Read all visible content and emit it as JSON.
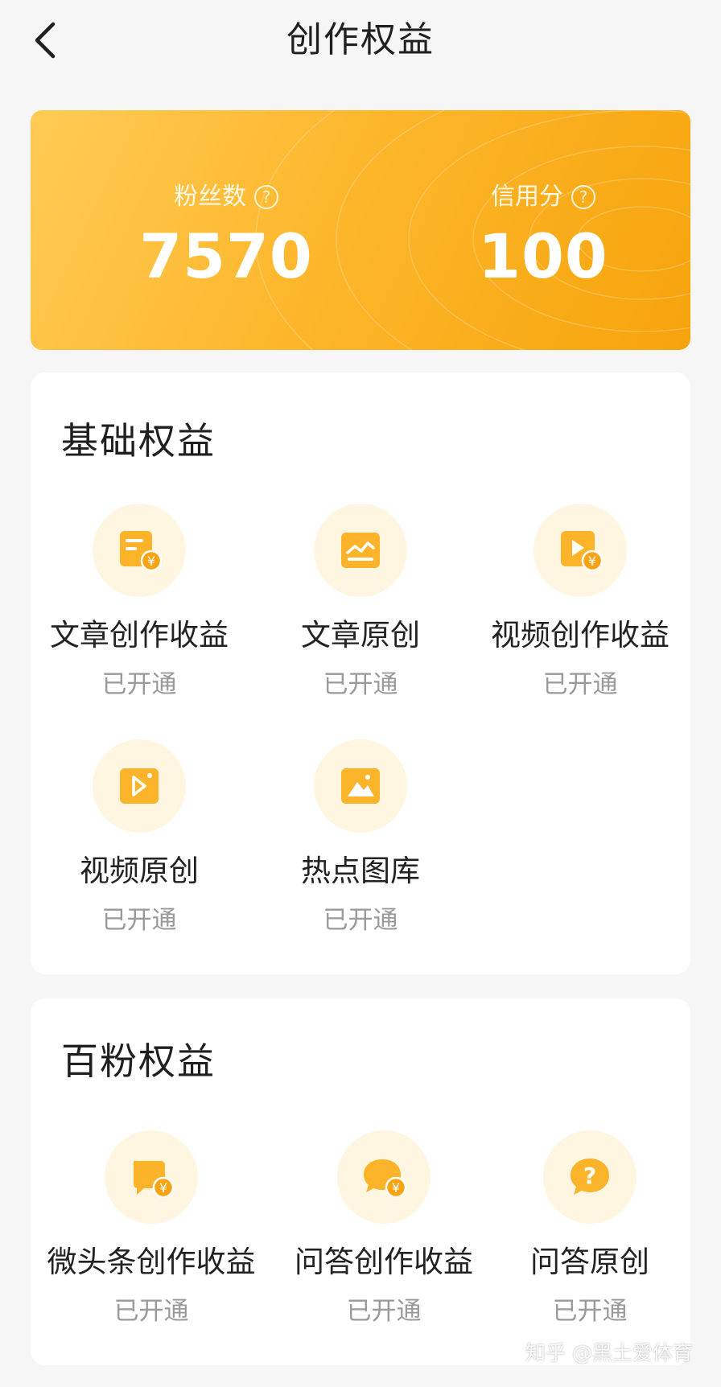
{
  "header": {
    "title": "创作权益"
  },
  "stats": {
    "fans_label": "粉丝数",
    "fans_value": "7570",
    "credit_label": "信用分",
    "credit_value": "100",
    "help_glyph": "?",
    "arrow_glyph": "›"
  },
  "basic": {
    "title": "基础权益",
    "items": [
      {
        "name": "文章创作收益",
        "status": "已开通",
        "icon": "article-income-icon"
      },
      {
        "name": "文章原创",
        "status": "已开通",
        "icon": "article-original-icon"
      },
      {
        "name": "视频创作收益",
        "status": "已开通",
        "icon": "video-income-icon"
      },
      {
        "name": "视频原创",
        "status": "已开通",
        "icon": "video-original-icon"
      },
      {
        "name": "热点图库",
        "status": "已开通",
        "icon": "image-gallery-icon"
      }
    ]
  },
  "fans100": {
    "title": "百粉权益",
    "items": [
      {
        "name": "微头条创作收益",
        "status": "已开通",
        "icon": "micro-post-income-icon"
      },
      {
        "name": "问答创作收益",
        "status": "已开通",
        "icon": "qa-income-icon"
      },
      {
        "name": "问答原创",
        "status": "已开通",
        "icon": "qa-original-icon"
      }
    ]
  },
  "watermark": "知乎 @黑土爱体育",
  "colors": {
    "accent": "#f6a40c",
    "icon_bg": "#fff6e2",
    "status_text": "#9a9a9a"
  }
}
